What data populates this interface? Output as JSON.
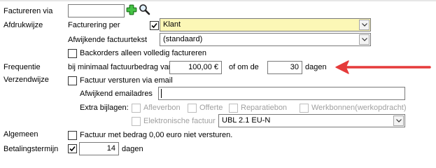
{
  "labels": {
    "facturerenVia": "Factureren via",
    "afdrukwijze": "Afdrukwijze",
    "frequentie": "Frequentie",
    "verzendwijze": "Verzendwijze",
    "algemeen": "Algemeen",
    "betalingstermijn": "Betalingstermijn"
  },
  "facturering": {
    "label": "Facturering per",
    "checked": true,
    "value": "Klant"
  },
  "afwijkende": {
    "label": "Afwijkende factuurtekst",
    "value": "(standaard)"
  },
  "backorders": {
    "label": "Backorders alleen volledig factureren",
    "checked": false
  },
  "frequentie": {
    "prefix": "bij minimaal factuurbedrag van",
    "amount": "100,00 €",
    "middle": "of om de",
    "days": "30",
    "suffix": "dagen"
  },
  "email": {
    "label": "Factuur versturen via email",
    "checked": false,
    "altLabel": "Afwijkend emailadres",
    "altValue": ""
  },
  "bijlagen": {
    "label": "Extra bijlagen:",
    "items": [
      "Afleverbon",
      "Offerte",
      "Reparatiebon",
      "Werkbonnen(werkopdracht)"
    ],
    "elektronisch": "Elektronische factuur",
    "format": "UBL 2.1 EU-N"
  },
  "algemeen": {
    "label": "Factuur met bedrag 0,00 euro niet versturen.",
    "checked": false
  },
  "betaling": {
    "checked": true,
    "days": "14",
    "suffix": "dagen"
  },
  "colors": {
    "arrow": "#e53b3b",
    "plusIcon": "#2e9b2e",
    "highlight": "#fcf7b6"
  },
  "icons": [
    "add-icon",
    "search-icon",
    "chevron-down-icon",
    "checkmark-icon",
    "arrow-left-icon"
  ]
}
